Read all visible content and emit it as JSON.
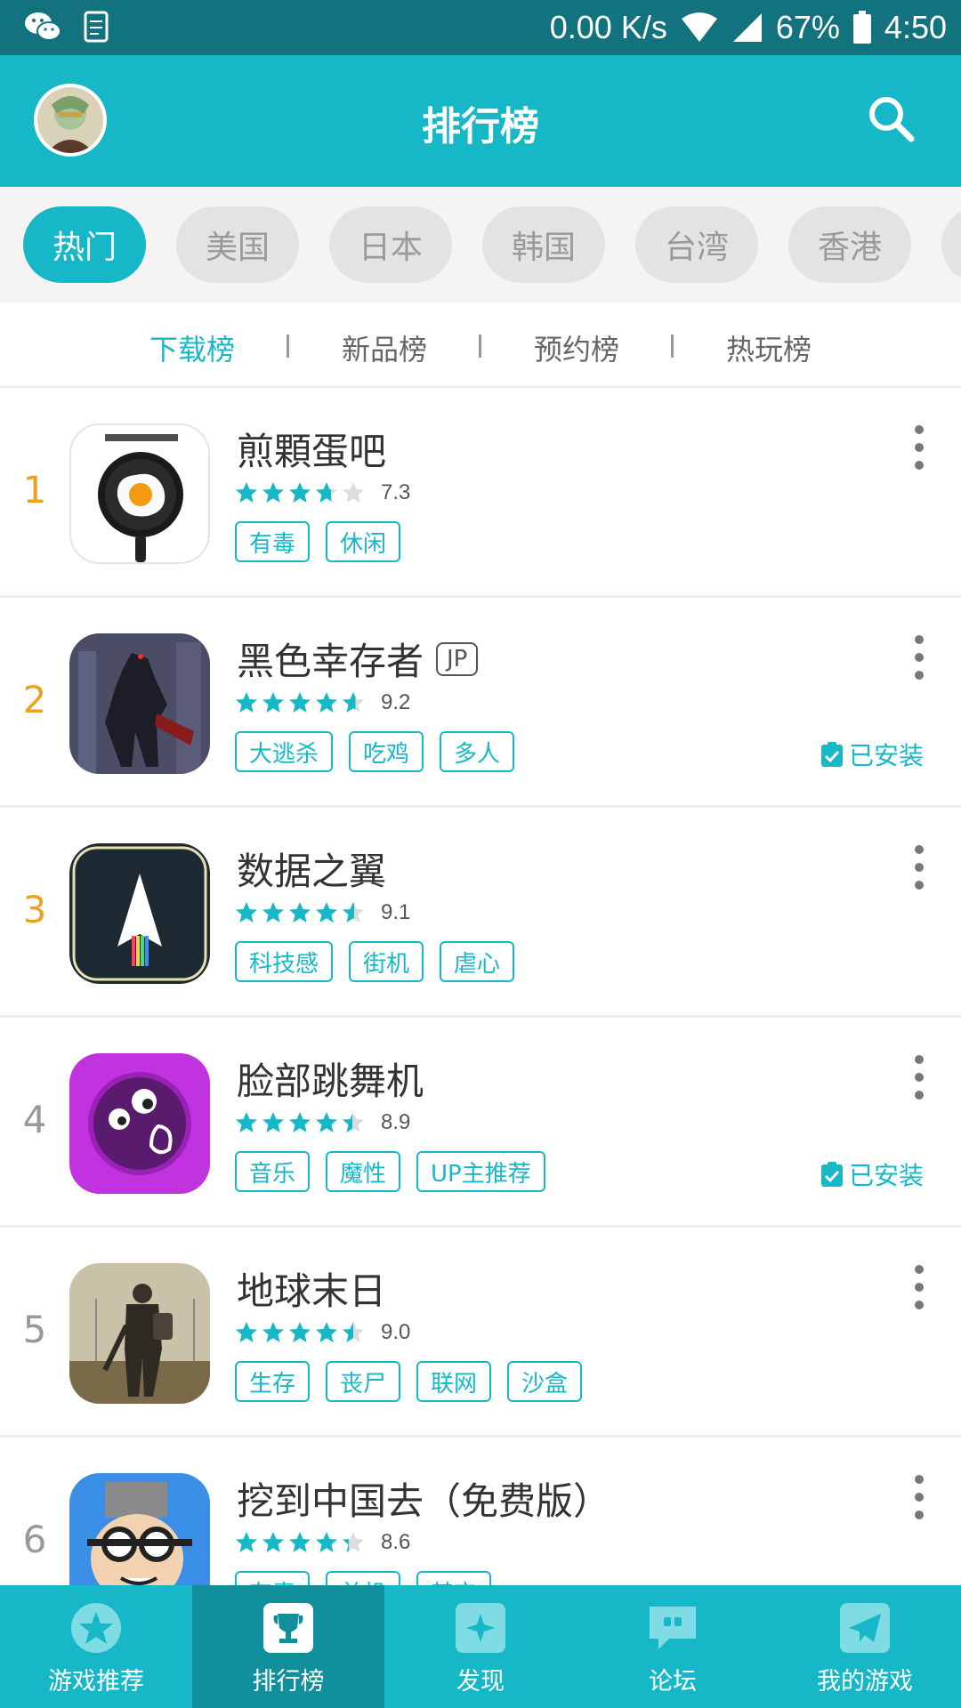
{
  "status_bar": {
    "net_speed": "0.00 K/s",
    "battery": "67%",
    "time": "4:50",
    "icons": [
      "wechat-icon",
      "clipboard-icon",
      "wifi-icon",
      "signal-icon",
      "battery-icon"
    ]
  },
  "header": {
    "title": "排行榜",
    "search_icon": "search-icon"
  },
  "regions": [
    "热门",
    "美国",
    "日本",
    "韩国",
    "台湾",
    "香港"
  ],
  "selected_region": "热门",
  "subtabs": [
    "下载榜",
    "新品榜",
    "预约榜",
    "热玩榜"
  ],
  "selected_subtab": "下载榜",
  "installed_label": "已安装",
  "apps": [
    {
      "rank": "1",
      "name": "煎顆蛋吧",
      "badge": "",
      "rating": 3.7,
      "score": "7.3",
      "tags": [
        "有毒",
        "休闲"
      ],
      "installed": false,
      "icon": "frying-pan-egg-icon"
    },
    {
      "rank": "2",
      "name": "黑色幸存者",
      "badge": "JP",
      "rating": 4.6,
      "score": "9.2",
      "tags": [
        "大逃杀",
        "吃鸡",
        "多人"
      ],
      "installed": true,
      "icon": "dark-survivor-icon"
    },
    {
      "rank": "3",
      "name": "数据之翼",
      "badge": "",
      "rating": 4.55,
      "score": "9.1",
      "tags": [
        "科技感",
        "街机",
        "虐心"
      ],
      "installed": false,
      "icon": "data-wing-icon"
    },
    {
      "rank": "4",
      "name": "脸部跳舞机",
      "badge": "",
      "rating": 4.45,
      "score": "8.9",
      "tags": [
        "音乐",
        "魔性",
        "UP主推荐"
      ],
      "installed": true,
      "icon": "face-dance-icon"
    },
    {
      "rank": "5",
      "name": "地球末日",
      "badge": "",
      "rating": 4.5,
      "score": "9.0",
      "tags": [
        "生存",
        "丧尸",
        "联网",
        "沙盒"
      ],
      "installed": false,
      "icon": "last-day-on-earth-icon"
    },
    {
      "rank": "6",
      "name": "挖到中国去（免费版）",
      "badge": "",
      "rating": 4.3,
      "score": "8.6",
      "tags": [
        "有毒",
        "单机",
        "其它"
      ],
      "installed": false,
      "icon": "dig-to-china-icon"
    }
  ],
  "bottom_nav": [
    {
      "label": "游戏推荐",
      "icon": "star-icon"
    },
    {
      "label": "排行榜",
      "icon": "trophy-icon"
    },
    {
      "label": "发现",
      "icon": "sparkle-icon"
    },
    {
      "label": "论坛",
      "icon": "forum-icon"
    },
    {
      "label": "我的游戏",
      "icon": "paper-plane-icon"
    }
  ],
  "selected_nav": "排行榜",
  "colors": {
    "accent": "#16b8c8",
    "status_bar": "#12737f",
    "rank_top": "#f0a020",
    "nav_active": "#118f9c"
  }
}
